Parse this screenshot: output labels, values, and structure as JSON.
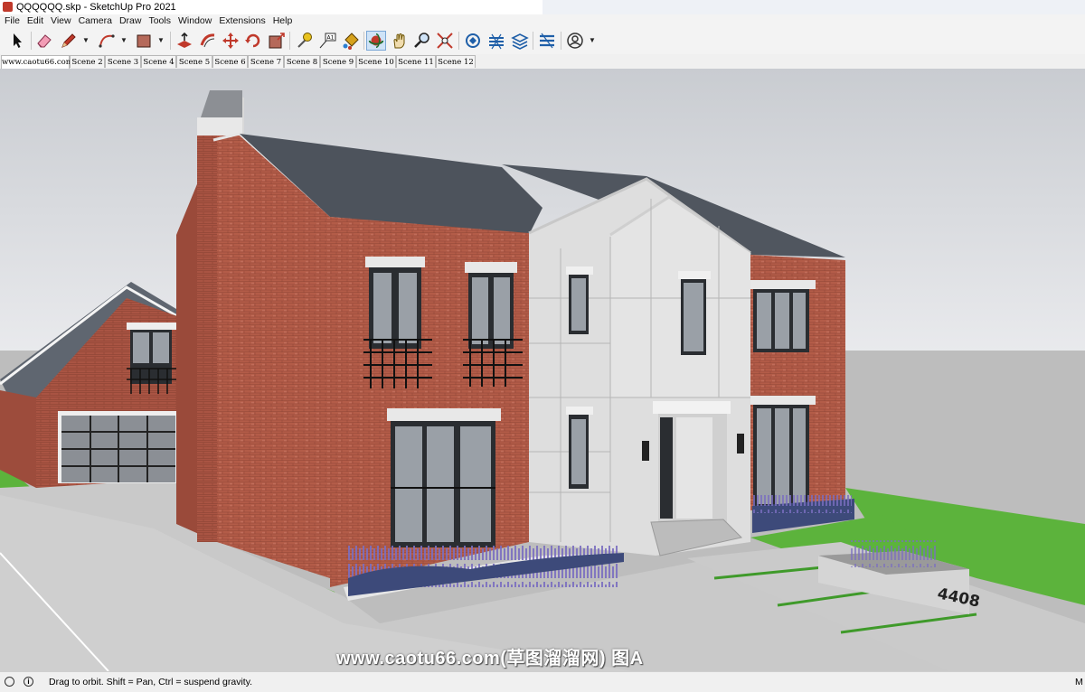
{
  "window": {
    "title": "QQQQQQ.skp - SketchUp Pro 2021"
  },
  "menu": [
    "File",
    "Edit",
    "View",
    "Camera",
    "Draw",
    "Tools",
    "Window",
    "Extensions",
    "Help"
  ],
  "toolbar": {
    "tools": [
      "select-tool",
      "eraser-tool",
      "line-tool",
      "arc-tool",
      "rectangle-tool",
      "push-pull-tool",
      "offset-tool",
      "move-tool",
      "rotate-tool",
      "scale-tool",
      "tape-measure-tool",
      "text-tool",
      "paint-bucket-tool",
      "orbit-tool",
      "pan-tool",
      "zoom-tool",
      "zoom-extents-tool",
      "warehouse-tool",
      "extension-tool",
      "components-tool",
      "layout-tool",
      "account-tool"
    ],
    "colors": {
      "accent": "#2d7fd1",
      "active_bg": "#cfe3f7"
    }
  },
  "scenes": [
    "www.caotu66.com",
    "Scene 2",
    "Scene 3",
    "Scene 4",
    "Scene 5",
    "Scene 6",
    "Scene 7",
    "Scene 8",
    "Scene 9",
    "Scene 10",
    "Scene 11",
    "Scene 12"
  ],
  "model": {
    "house_number": "4408"
  },
  "status": {
    "hint": "Drag to orbit. Shift = Pan, Ctrl = suspend gravity.",
    "right_label": "M"
  },
  "watermark": "www.caotu66.com(草图溜溜网) 图A"
}
